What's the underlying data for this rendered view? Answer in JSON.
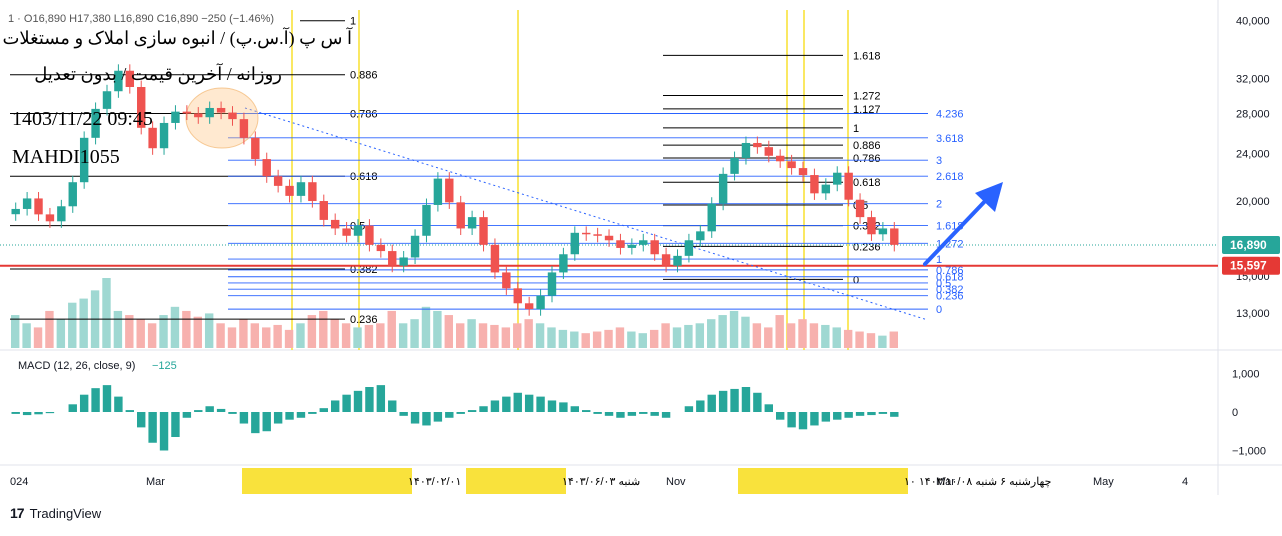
{
  "header": {
    "ohlc_text": "1  ·  O16,890  H17,380  L16,890  C16,890  −250 (−1.46%)",
    "title_fa": "آ س پ (آ.س.پ) / انبوه سازی املاک و مستغلات",
    "subtitle_fa": "روزانه / آخرین قیمت / بدون تعدیل",
    "datetime": "1403/11/22 09:45",
    "author": "MAHDI1055"
  },
  "branding": {
    "logo_text": "17",
    "name": "TradingView"
  },
  "colors": {
    "up": "#26a69a",
    "down": "#ef5350",
    "fib_blue": "#2962ff",
    "yellow": "#f9e23c",
    "support_red": "#e53935",
    "price_tag": "#26a69a",
    "support_tag": "#e53935"
  },
  "chart_data": {
    "type": "candlestick",
    "price_axis": {
      "scale": "log",
      "ticks": [
        13000,
        15000,
        20000,
        24000,
        28000,
        32000,
        40000
      ]
    },
    "time_axis": {
      "labels": [
        "024",
        "Mar",
        "Nov",
        "Mar",
        "May",
        "4"
      ]
    },
    "last_price": {
      "value": 16890,
      "label": "16,890"
    },
    "support_level": {
      "value": 15597,
      "label": "15,597"
    },
    "series": [
      {
        "name": "price",
        "closes": [
          19400,
          20200,
          19000,
          18500,
          19600,
          21500,
          25500,
          28500,
          30500,
          33000,
          31000,
          26500,
          24500,
          27000,
          28200,
          28000,
          27600,
          28600,
          28100,
          27400,
          25500,
          23500,
          22000,
          21200,
          20400,
          21500,
          20000,
          18600,
          18000,
          17500,
          18200,
          16900,
          16500,
          15600,
          16100,
          17500,
          19700,
          21800,
          19900,
          18000,
          18800,
          16900,
          15200,
          14300,
          13500,
          13200,
          13900,
          15200,
          16300,
          17700,
          17600,
          17500,
          17200,
          16700,
          16900,
          17200,
          16300,
          15600,
          16200,
          17200,
          17800,
          19800,
          22200,
          23600,
          25000,
          24600,
          23800,
          23300,
          22700,
          22100,
          20600,
          21300,
          22300,
          20100,
          18800,
          17600,
          18000,
          16900
        ]
      }
    ],
    "fib_black_left": {
      "levels": [
        "1",
        "0.886",
        "0.786",
        "0.618",
        "0.5",
        "0.382",
        "0.236"
      ],
      "prices": [
        40000,
        32500,
        28000,
        22000,
        18200,
        15400,
        12700
      ]
    },
    "fib_black_right": {
      "levels": [
        "1.618",
        "1.272",
        "1.127",
        "1",
        "0.886",
        "0.786",
        "0.618",
        "0.5",
        "0.382",
        "0.236",
        "0"
      ],
      "prices": [
        35000,
        30000,
        28500,
        26500,
        24800,
        23600,
        21500,
        19700,
        18200,
        16800,
        14800
      ]
    },
    "fib_blue": {
      "levels": [
        "4.236",
        "3.618",
        "3",
        "2.618",
        "2",
        "1.618",
        "1.272",
        "1",
        "0.786",
        "0.618",
        "0.5",
        "0.382",
        "0.236",
        "0"
      ],
      "prices": [
        28000,
        25500,
        23400,
        22000,
        19800,
        18200,
        17000,
        16000,
        15350,
        14950,
        14600,
        14250,
        13900,
        13200
      ]
    },
    "volume": [
      40,
      30,
      25,
      45,
      35,
      55,
      60,
      70,
      85,
      45,
      40,
      35,
      30,
      40,
      50,
      45,
      38,
      42,
      30,
      25,
      35,
      30,
      25,
      28,
      22,
      30,
      40,
      45,
      35,
      30,
      25,
      28,
      30,
      45,
      30,
      35,
      50,
      45,
      40,
      30,
      35,
      30,
      28,
      25,
      30,
      35,
      30,
      25,
      22,
      20,
      18,
      20,
      22,
      25,
      20,
      18,
      22,
      30,
      25,
      28,
      30,
      35,
      40,
      45,
      38,
      30,
      25,
      40,
      30,
      35,
      30,
      28,
      25,
      22,
      20,
      18,
      15,
      20
    ],
    "macd": {
      "label": "MACD (12, 26, close, 9)",
      "value_label": "−125",
      "axis_ticks": [
        1000,
        0,
        -1000
      ],
      "axis_tick_labels": [
        "1,000",
        "0",
        "−1,000"
      ],
      "histogram": [
        -50,
        -80,
        -60,
        -30,
        0,
        200,
        450,
        620,
        700,
        400,
        50,
        -400,
        -800,
        -1000,
        -650,
        -150,
        50,
        150,
        80,
        -50,
        -300,
        -550,
        -500,
        -300,
        -200,
        -150,
        -50,
        100,
        300,
        450,
        550,
        650,
        700,
        300,
        -100,
        -300,
        -350,
        -250,
        -150,
        -50,
        50,
        150,
        300,
        400,
        500,
        450,
        400,
        300,
        250,
        150,
        50,
        -50,
        -100,
        -150,
        -100,
        -50,
        -100,
        -150,
        0,
        150,
        300,
        450,
        550,
        600,
        650,
        500,
        200,
        -200,
        -400,
        -450,
        -350,
        -250,
        -200,
        -150,
        -100,
        -80,
        -50,
        -125
      ]
    },
    "yellow_date_labels": [
      {
        "text": "سه‌شنبه ۱۴۰۳/۰۳/۲۲   ۱۴۰۳/۰۲/۰۱"
      },
      {
        "text": "شنبه ۱۴۰۳/۰۶/۰۳"
      },
      {
        "text": "چهارشنبه ۶  شنبه ۱۴۰۳/۱۰/۰۸  ۱۰"
      }
    ]
  }
}
